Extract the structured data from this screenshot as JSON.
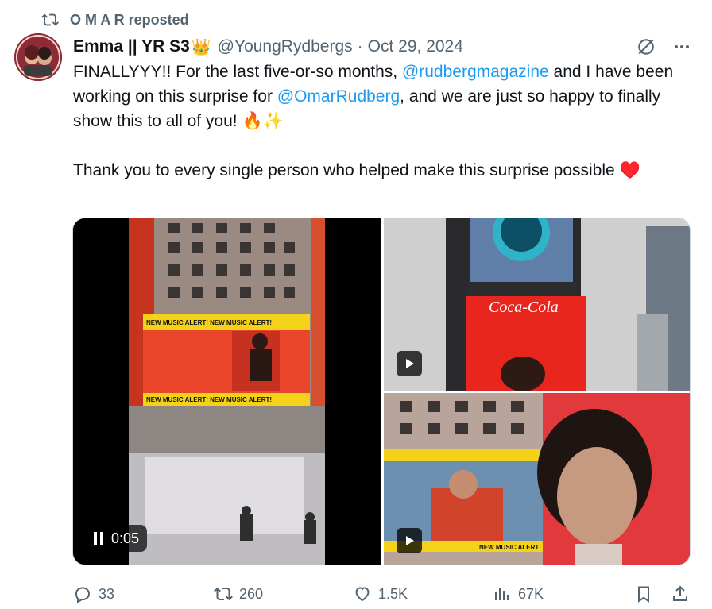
{
  "repost": {
    "icon": "repost-icon",
    "label": "O M A R reposted"
  },
  "author": {
    "display_name": "Emma || YR S3",
    "badge_emoji": "👑",
    "handle": "@YoungRydbergs",
    "separator": "·",
    "date": "Oct 29, 2024"
  },
  "tweet": {
    "p1_a": "FINALLYYY!! For the last five-or-so months, ",
    "mention1": "@rudbergmagazine",
    "p1_b": " and I have been working on this surprise for ",
    "mention2": "@OmarRudberg",
    "p1_c": ", and we are just so happy to finally show this to all of you! 🔥✨",
    "p2": "Thank you to every single person who helped make this surprise possible ♥️"
  },
  "media": {
    "video_time": "0:05",
    "left_banner_text": "NEW MUSIC ALERT!  NEW MUSIC ALERT!",
    "tr_brand": "Coca-Cola",
    "br_banner_text": "NEW MUSIC ALERT!"
  },
  "actions": {
    "replies": "33",
    "reposts": "260",
    "likes": "1.5K",
    "views": "67K"
  },
  "colors": {
    "accent": "#1d9bf0",
    "muted": "#536471",
    "text": "#0f1419"
  }
}
